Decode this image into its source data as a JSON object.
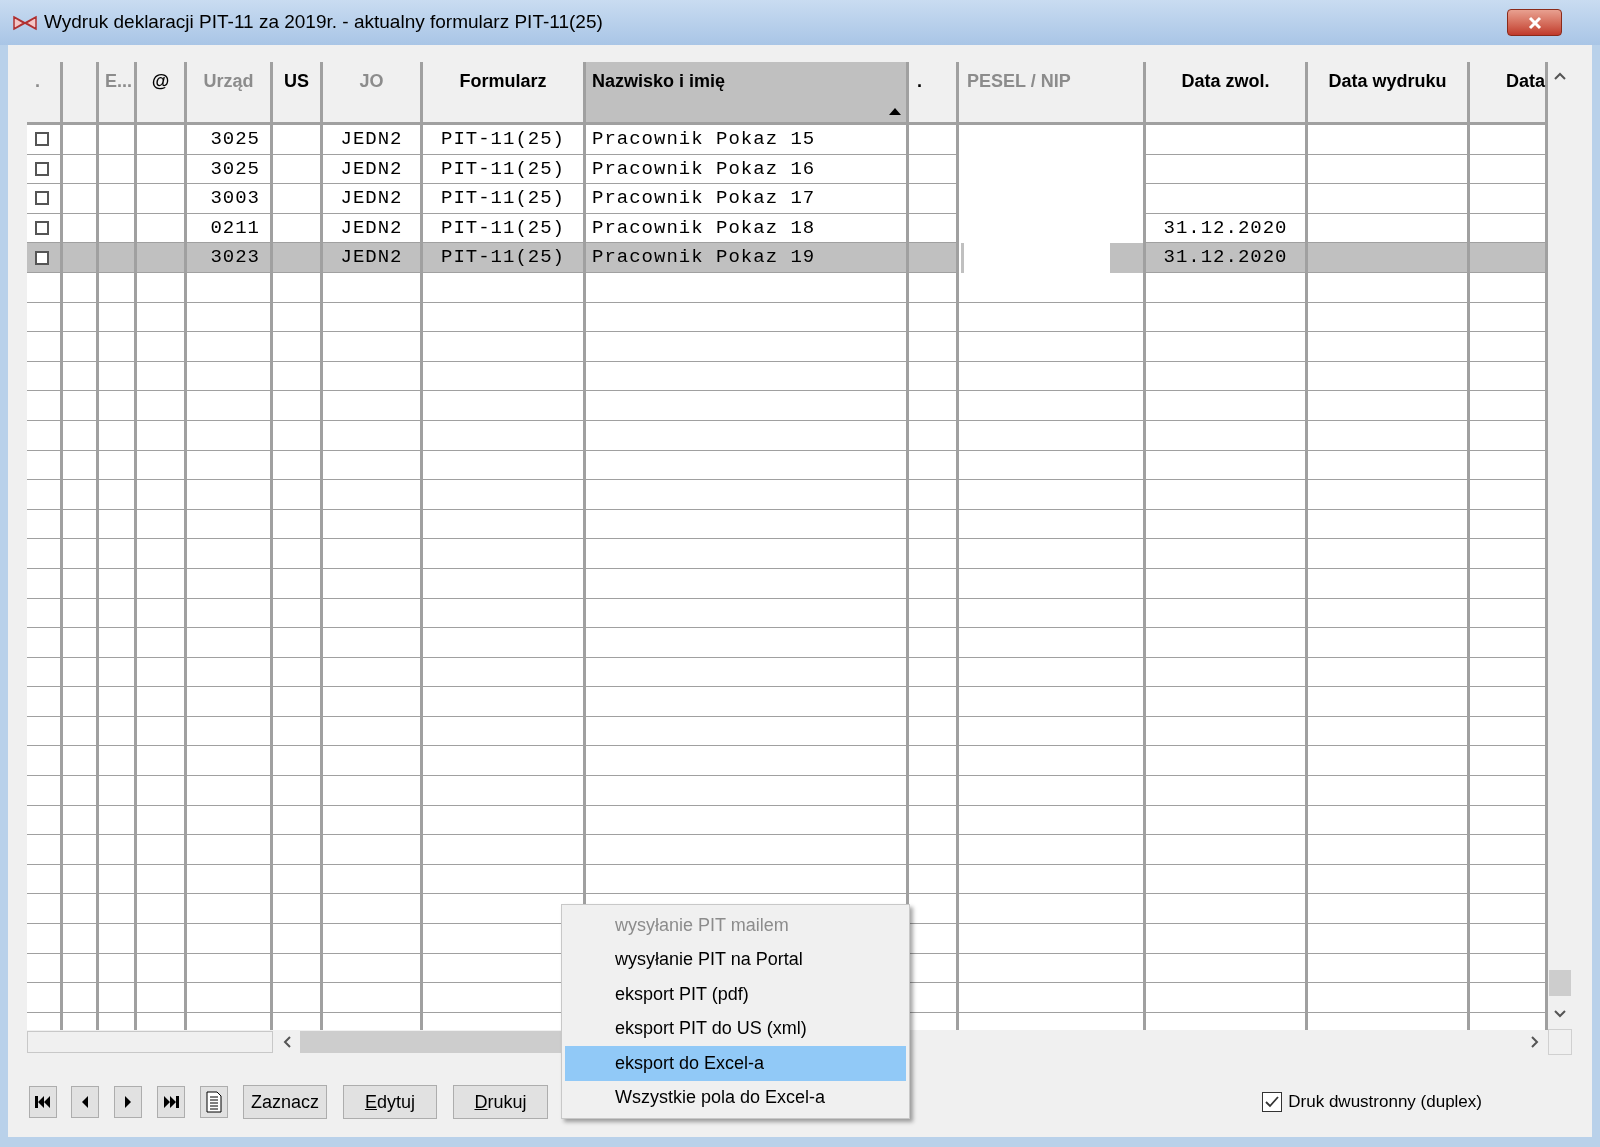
{
  "window": {
    "title": "Wydruk deklaracji PIT-11 za 2019r. - aktualny formularz PIT-11(25)"
  },
  "table": {
    "columns": [
      {
        "label": ".",
        "dimmed": true,
        "sorted": false
      },
      {
        "dimmed": false,
        "sorted": false
      },
      {
        "label": "E...",
        "dimmed": true,
        "sorted": false
      },
      {
        "label": "@",
        "dimmed": false,
        "sorted": false
      },
      {
        "label": "Urząd",
        "dimmed": true,
        "sorted": false
      },
      {
        "label": "US",
        "dimmed": false,
        "sorted": false
      },
      {
        "label": "JO",
        "dimmed": true,
        "sorted": false
      },
      {
        "label": "Formularz",
        "dimmed": false,
        "sorted": false
      },
      {
        "label": "Nazwisko i imię",
        "dimmed": false,
        "sorted": true
      },
      {
        "label": ".",
        "dimmed": false,
        "sorted": false
      },
      {
        "label": "PESEL / NIP",
        "dimmed": true,
        "sorted": false
      },
      {
        "label": "Data zwol.",
        "dimmed": false,
        "sorted": false
      },
      {
        "label": "Data wydruku",
        "dimmed": false,
        "sorted": false
      },
      {
        "label": "Data",
        "dimmed": false,
        "sorted": false
      }
    ],
    "rows": [
      {
        "checked": false,
        "selected": false,
        "urzad": "3025",
        "jo": "JEDN2",
        "formularz": "PIT-11(25)",
        "nazwisko": "Pracownik Pokaz 15"
      },
      {
        "checked": false,
        "selected": false,
        "urzad": "3025",
        "jo": "JEDN2",
        "formularz": "PIT-11(25)",
        "nazwisko": "Pracownik Pokaz 16"
      },
      {
        "checked": false,
        "selected": false,
        "urzad": "3003",
        "jo": "JEDN2",
        "formularz": "PIT-11(25)",
        "nazwisko": "Pracownik Pokaz 17"
      },
      {
        "checked": false,
        "selected": false,
        "urzad": "0211",
        "jo": "JEDN2",
        "formularz": "PIT-11(25)",
        "nazwisko": "Pracownik Pokaz 18",
        "data_zwol": "31.12.2020"
      },
      {
        "checked": false,
        "selected": true,
        "urzad": "3023",
        "jo": "JEDN2",
        "formularz": "PIT-11(25)",
        "nazwisko": "Pracownik Pokaz 19",
        "data_zwol": "31.12.2020"
      }
    ]
  },
  "buttons": [
    {
      "label": "Zaznacz",
      "accelerator": false
    },
    {
      "label": "Edytuj",
      "accelerator": true
    },
    {
      "label": "Drukuj",
      "accelerator": true
    }
  ],
  "duplex": {
    "label": "Druk dwustronny (duplex)",
    "checked": true
  },
  "context_menu": [
    {
      "label": "wysyłanie PIT mailem",
      "disabled": true,
      "selected": false
    },
    {
      "label": "wysyłanie PIT na Portal",
      "disabled": false,
      "selected": false
    },
    {
      "label": "eksport PIT (pdf)",
      "disabled": false,
      "selected": false
    },
    {
      "label": "eksport PIT do US (xml)",
      "disabled": false,
      "selected": false
    },
    {
      "label": "eksport do Excel-a",
      "disabled": false,
      "selected": true
    },
    {
      "label": "Wszystkie pola do Excel-a",
      "disabled": false,
      "selected": false
    }
  ]
}
